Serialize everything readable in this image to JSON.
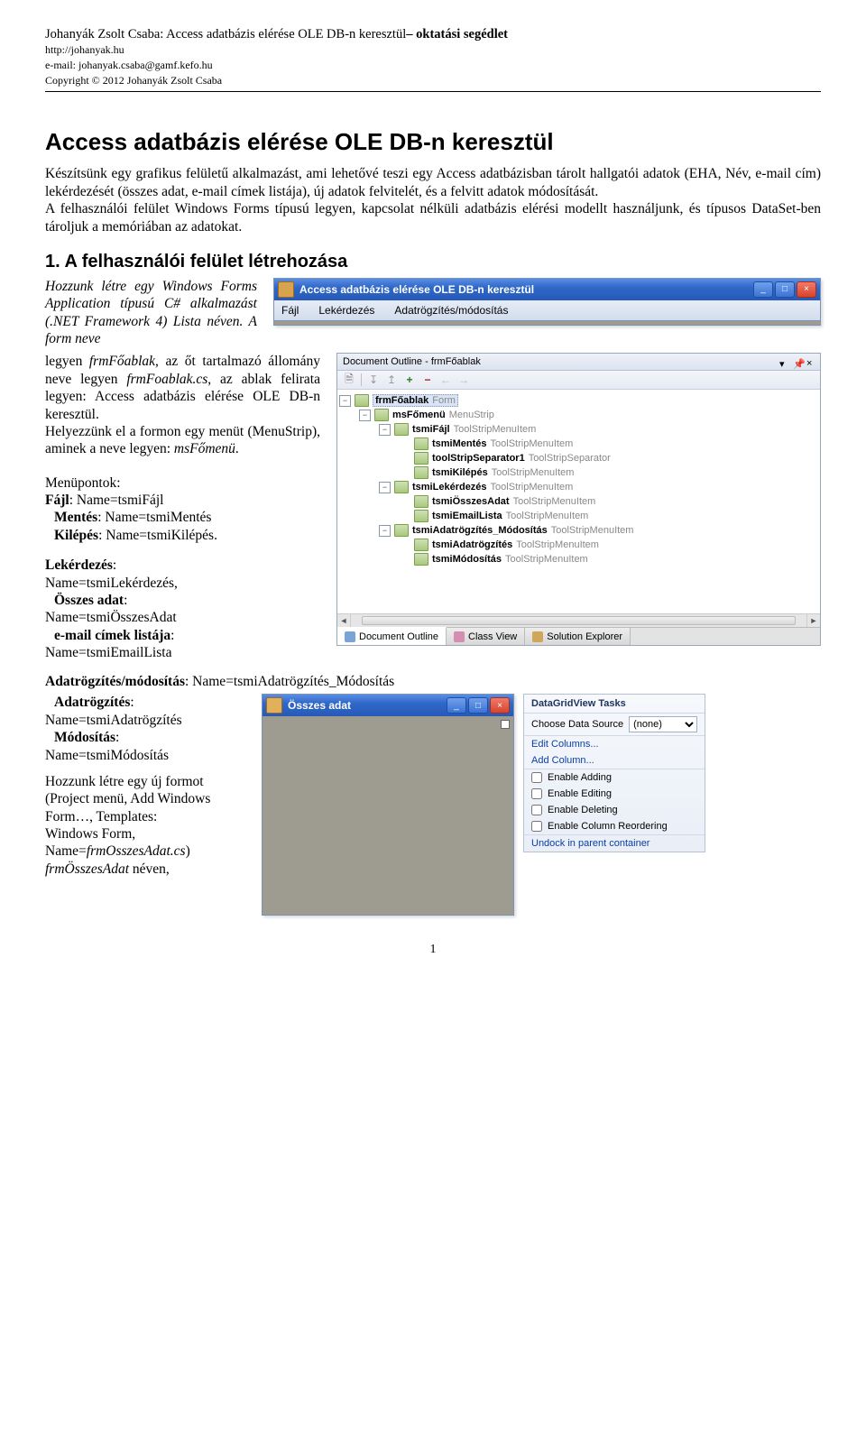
{
  "header": {
    "author": "Johanyák Zsolt Csaba: ",
    "title_plain": "Access adatbázis elérése OLE DB-n keresztül",
    "title_bold_suffix": "– oktatási segédlet",
    "url": "http://johanyak.hu",
    "email": "e-mail: johanyak.csaba@gamf.kefo.hu",
    "copyright": "Copyright © 2012 Johanyák Zsolt Csaba"
  },
  "main_title": "Access adatbázis elérése OLE DB-n keresztül",
  "intro": "Készítsünk egy grafikus felületű alkalmazást, ami lehetővé teszi egy Access adatbázisban tárolt hallgatói adatok (EHA, Név, e-mail cím) lekérdezését (összes adat, e-mail címek listája), új adatok felvitelét, és a felvitt adatok módosítását.\nA felhasználói felület Windows Forms típusú legyen, kapcsolat nélküli adatbázis elérési modellt használjunk, és típusos DataSet-ben tároljuk a memóriában az adatokat.",
  "section1_title": "1. A felhasználói felület létrehozása",
  "para1": "Hozzunk létre egy Windows Forms Application típusú C# alkalmazást (.NET Framework 4) Lista néven. A form neve",
  "app_win": {
    "title": "Access adatbázis elérése OLE DB-n keresztül",
    "menu": [
      "Fájl",
      "Lekérdezés",
      "Adatrögzítés/módosítás"
    ]
  },
  "para2_a": "legyen ",
  "para2_b": "frmFőablak",
  "para2_c": ", az őt tartalmazó állomány neve legyen ",
  "para2_d": "frmFoablak.cs",
  "para2_e": ", az ablak felirata legyen: Access adatbázis elérése OLE DB-n keresztül.",
  "para2_f": "Helyezzünk el a formon egy menüt (MenuStrip), aminek a neve legyen: ",
  "para2_g": "msFőmenü",
  "para2_h": ".",
  "para3_label": "Menüpontok:",
  "para3_items": [
    {
      "b": "Fájl",
      "t": ": Name=tsmiFájl"
    },
    {
      "b": "  Mentés",
      "t": ": Name=tsmiMentés"
    },
    {
      "b": "  Kilépés",
      "t": ": Name=tsmiKilépés."
    }
  ],
  "para4_items": [
    {
      "b": "Lekérdezés",
      "t": ":"
    },
    {
      "b": "",
      "t": "Name=tsmiLekérdezés,"
    },
    {
      "b": "  Összes adat",
      "t": ":"
    },
    {
      "b": "",
      "t": "Name=tsmiÖsszesAdat"
    },
    {
      "b": "  e-mail címek listája",
      "t": ":"
    },
    {
      "b": "",
      "t": "Name=tsmiEmailLista"
    }
  ],
  "doc_outline": {
    "title": "Document Outline - frmFőablak",
    "nodes": [
      {
        "d": 0,
        "pm": "-",
        "name": "frmFőablak",
        "type": "Form",
        "sel": true
      },
      {
        "d": 1,
        "pm": "-",
        "name": "msFőmenü",
        "type": "MenuStrip"
      },
      {
        "d": 2,
        "pm": "-",
        "name": "tsmiFájl",
        "type": "ToolStripMenuItem"
      },
      {
        "d": 3,
        "pm": "",
        "name": "tsmiMentés",
        "type": "ToolStripMenuItem"
      },
      {
        "d": 3,
        "pm": "",
        "name": "toolStripSeparator1",
        "type": "ToolStripSeparator"
      },
      {
        "d": 3,
        "pm": "",
        "name": "tsmiKilépés",
        "type": "ToolStripMenuItem"
      },
      {
        "d": 2,
        "pm": "-",
        "name": "tsmiLekérdezés",
        "type": "ToolStripMenuItem"
      },
      {
        "d": 3,
        "pm": "",
        "name": "tsmiÖsszesAdat",
        "type": "ToolStripMenuItem"
      },
      {
        "d": 3,
        "pm": "",
        "name": "tsmiEmailLista",
        "type": "ToolStripMenuItem"
      },
      {
        "d": 2,
        "pm": "-",
        "name": "tsmiAdatrögzítés_Módosítás",
        "type": "ToolStripMenuItem"
      },
      {
        "d": 3,
        "pm": "",
        "name": "tsmiAdatrögzítés",
        "type": "ToolStripMenuItem"
      },
      {
        "d": 3,
        "pm": "",
        "name": "tsmiMódosítás",
        "type": "ToolStripMenuItem"
      }
    ],
    "tabs": [
      "Document Outline",
      "Class View",
      "Solution Explorer"
    ]
  },
  "para5_line1": {
    "b": "Adatrögzítés/módosítás",
    "t": ": Name=tsmiAdatrögzítés_Módosítás"
  },
  "para5_items": [
    {
      "b": "  Adatrögzítés",
      "t": ":"
    },
    {
      "b": "",
      "t": "Name=tsmiAdatrögzítés"
    },
    {
      "b": "  Módosítás",
      "t": ":"
    },
    {
      "b": "",
      "t": "Name=tsmiMódosítás"
    }
  ],
  "para6": [
    "Hozzunk létre egy új formot",
    "(Project menü, Add Windows",
    "Form…, Templates:",
    "Windows Form,"
  ],
  "para6_b": "Name=",
  "para6_i": "frmOsszesAdat.cs",
  "para6_c": ")",
  "para6_d": "frmÖsszesAdat",
  "para6_e": " néven,",
  "oa_win": {
    "title": "Összes adat"
  },
  "tasks": {
    "title": "DataGridView Tasks",
    "ds_label": "Choose Data Source",
    "ds_value": "(none)",
    "links": [
      "Edit Columns...",
      "Add Column..."
    ],
    "checks": [
      "Enable Adding",
      "Enable Editing",
      "Enable Deleting",
      "Enable Column Reordering"
    ],
    "undock": "Undock in parent container"
  },
  "page_number": "1"
}
